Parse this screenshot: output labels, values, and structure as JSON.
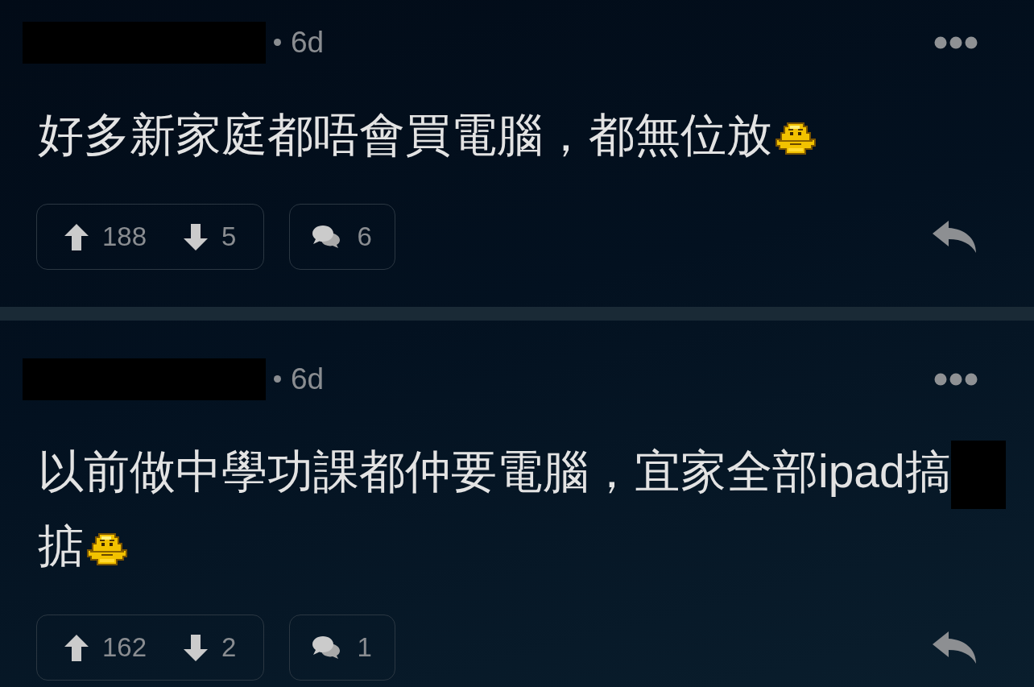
{
  "comments": [
    {
      "author_redacted": true,
      "time": "6d",
      "body": [
        {
          "kind": "text",
          "text": "好多新家庭都唔會買電腦，都無位放"
        },
        {
          "kind": "emoji"
        }
      ],
      "upvotes": "188",
      "downvotes": "5",
      "replies": "6"
    },
    {
      "author_redacted": true,
      "time": "6d",
      "body": [
        {
          "kind": "text",
          "text": "以前做中學功課都仲要電腦，宜家全部ipad搞"
        },
        {
          "kind": "redaction"
        },
        {
          "kind": "text",
          "text": "掂"
        },
        {
          "kind": "emoji"
        }
      ],
      "upvotes": "162",
      "downvotes": "2",
      "replies": "1"
    }
  ]
}
